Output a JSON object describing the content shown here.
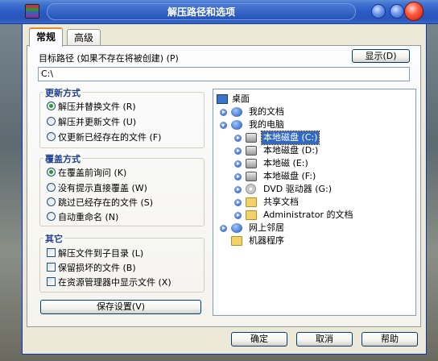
{
  "window": {
    "title": "解压路径和选项"
  },
  "tabs": [
    {
      "label": "常规"
    },
    {
      "label": "高级"
    }
  ],
  "destination": {
    "label": "目标路径 (如果不存在将被创建) (P)",
    "value": "C:\\",
    "show_button": "显示(D)"
  },
  "update_mode": {
    "title": "更新方式",
    "options": [
      {
        "label": "解压并替换文件 (R)",
        "checked": true
      },
      {
        "label": "解压并更新文件 (U)",
        "checked": false
      },
      {
        "label": "仅更新已经存在的文件 (F)",
        "checked": false
      }
    ]
  },
  "overwrite_mode": {
    "title": "覆盖方式",
    "options": [
      {
        "label": "在覆盖前询问 (K)",
        "checked": true
      },
      {
        "label": "没有提示直接覆盖 (W)",
        "checked": false
      },
      {
        "label": "跳过已经存在的文件 (S)",
        "checked": false
      },
      {
        "label": "自动重命名 (N)",
        "checked": false
      }
    ]
  },
  "misc": {
    "title": "其它",
    "options": [
      {
        "label": "解压文件到子目录 (L)",
        "checked": false
      },
      {
        "label": "保留损坏的文件 (B)",
        "checked": false
      },
      {
        "label": "在资源管理器中显示文件 (X)",
        "checked": false
      }
    ]
  },
  "save_settings_button": "保存设置(V)",
  "tree": {
    "nodes": [
      {
        "label": "桌面",
        "icon": "desktop-icon"
      },
      {
        "label": "我的文档",
        "icon": "my-documents-icon"
      },
      {
        "label": "我的电脑",
        "icon": "my-computer-icon"
      },
      {
        "label": "本地磁盘 (C:)",
        "icon": "drive-icon",
        "selected": true
      },
      {
        "label": "本地磁盘 (D:)",
        "icon": "drive-icon"
      },
      {
        "label": "本地磁 (E:)",
        "icon": "drive-icon"
      },
      {
        "label": "本地磁盘 (F:)",
        "icon": "drive-icon"
      },
      {
        "label": "DVD 驱动器 (G:)",
        "icon": "dvd-drive-icon"
      },
      {
        "label": "共享文档",
        "icon": "folder-icon"
      },
      {
        "label": "Administrator 的文档",
        "icon": "folder-icon"
      },
      {
        "label": "网上邻居",
        "icon": "network-icon"
      },
      {
        "label": "机器程序",
        "icon": "folder-icon"
      }
    ]
  },
  "footer": {
    "ok": "确定",
    "cancel": "取消",
    "help": "帮助"
  }
}
